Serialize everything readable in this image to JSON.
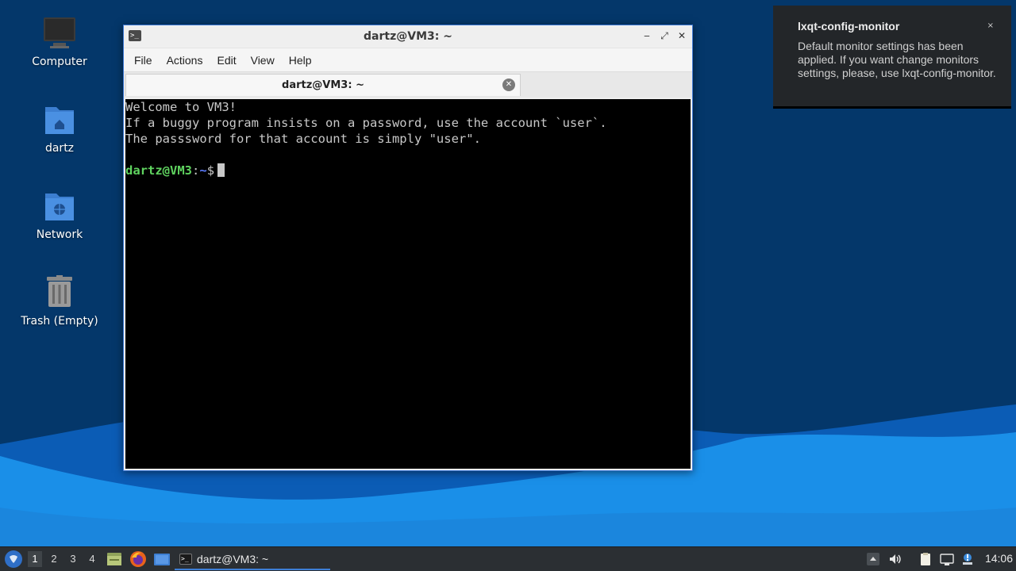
{
  "colors": {
    "wallpaper_dark": "#04376a",
    "wallpaper_wave": "#1a8fe8",
    "accent": "#3d7fd6",
    "terminal_bg": "#000000",
    "prompt_user": "#5fd35f",
    "prompt_path": "#5c7cff"
  },
  "desktop": {
    "icons": [
      {
        "label": "Computer",
        "icon": "computer-icon"
      },
      {
        "label": "dartz",
        "icon": "home-folder-icon"
      },
      {
        "label": "Network",
        "icon": "network-folder-icon"
      },
      {
        "label": "Trash (Empty)",
        "icon": "trash-icon"
      }
    ]
  },
  "window": {
    "title": "dartz@VM3: ~",
    "icon": "terminal-icon",
    "controls": {
      "minimize": "‒",
      "maximize": "⤢",
      "close": "✕"
    },
    "menu": [
      "File",
      "Actions",
      "Edit",
      "View",
      "Help"
    ],
    "tab": {
      "label": "dartz@VM3: ~",
      "close": "✕"
    }
  },
  "terminal": {
    "lines": [
      "Welcome to VM3!",
      "If a buggy program insists on a password, use the account `user`.",
      "The passsword for that account is simply \"user\"."
    ],
    "prompt": {
      "user_host": "dartz@VM3",
      "separator": ":",
      "path": "~",
      "symbol": "$"
    }
  },
  "notification": {
    "title": "lxqt-config-monitor",
    "body": "Default monitor settings has been applied. If you want change monitors settings, please, use lxqt-config-monitor.",
    "close": "×"
  },
  "taskbar": {
    "start_icon": "lxqt-start-icon",
    "desktops": [
      "1",
      "2",
      "3",
      "4"
    ],
    "active_desktop": "1",
    "launchers": [
      "file-manager-icon",
      "firefox-icon",
      "show-desktop-icon"
    ],
    "task_label": "dartz@VM3: ~",
    "tray": [
      "tray-up-arrow-icon",
      "volume-icon",
      "clipboard-icon",
      "network-icon",
      "update-notifier-icon"
    ],
    "clock": "14:06"
  }
}
